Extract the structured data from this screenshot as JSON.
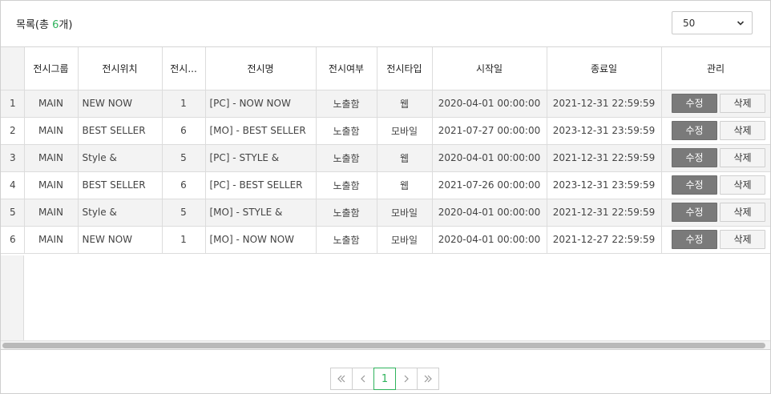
{
  "header": {
    "title_prefix": "목록(총 ",
    "total_count": "6",
    "title_suffix": "개)",
    "page_size": "50"
  },
  "columns": [
    "",
    "전시그룹",
    "전시위치",
    "전시...",
    "전시명",
    "전시여부",
    "전시타입",
    "시작일",
    "종료일",
    "관리"
  ],
  "rows": [
    {
      "no": "1",
      "group": "MAIN",
      "position": "NEW NOW",
      "order": "1",
      "name": "[PC] - NOW NOW",
      "visible": "노출함",
      "type": "웹",
      "start": "2020-04-01 00:00:00",
      "end": "2021-12-31 22:59:59"
    },
    {
      "no": "2",
      "group": "MAIN",
      "position": "BEST SELLER",
      "order": "6",
      "name": "[MO] - BEST SELLER",
      "visible": "노출함",
      "type": "모바일",
      "start": "2021-07-27 00:00:00",
      "end": "2023-12-31 23:59:59"
    },
    {
      "no": "3",
      "group": "MAIN",
      "position": "Style &",
      "order": "5",
      "name": "[PC] - STYLE &",
      "visible": "노출함",
      "type": "웹",
      "start": "2020-04-01 00:00:00",
      "end": "2021-12-31 22:59:59"
    },
    {
      "no": "4",
      "group": "MAIN",
      "position": "BEST SELLER",
      "order": "6",
      "name": "[PC] - BEST SELLER",
      "visible": "노출함",
      "type": "웹",
      "start": "2021-07-26 00:00:00",
      "end": "2023-12-31 23:59:59"
    },
    {
      "no": "5",
      "group": "MAIN",
      "position": "Style &",
      "order": "5",
      "name": "[MO] - STYLE &",
      "visible": "노출함",
      "type": "모바일",
      "start": "2020-04-01 00:00:00",
      "end": "2021-12-31 22:59:59"
    },
    {
      "no": "6",
      "group": "MAIN",
      "position": "NEW NOW",
      "order": "1",
      "name": "[MO] - NOW NOW",
      "visible": "노출함",
      "type": "모바일",
      "start": "2020-04-01 00:00:00",
      "end": "2021-12-27 22:59:59"
    }
  ],
  "actions": {
    "edit": "수정",
    "delete": "삭제"
  },
  "pagination": {
    "current": "1"
  },
  "colors": {
    "accent": "#2fb35c",
    "edit_button": "#7a7a7a",
    "row_alt": "#f3f3f3",
    "border": "#dcdcdc"
  },
  "icons": {
    "page_size": "chevron-down-icon",
    "first": "double-chevron-left-icon",
    "prev": "chevron-left-icon",
    "next": "chevron-right-icon",
    "last": "double-chevron-right-icon"
  }
}
